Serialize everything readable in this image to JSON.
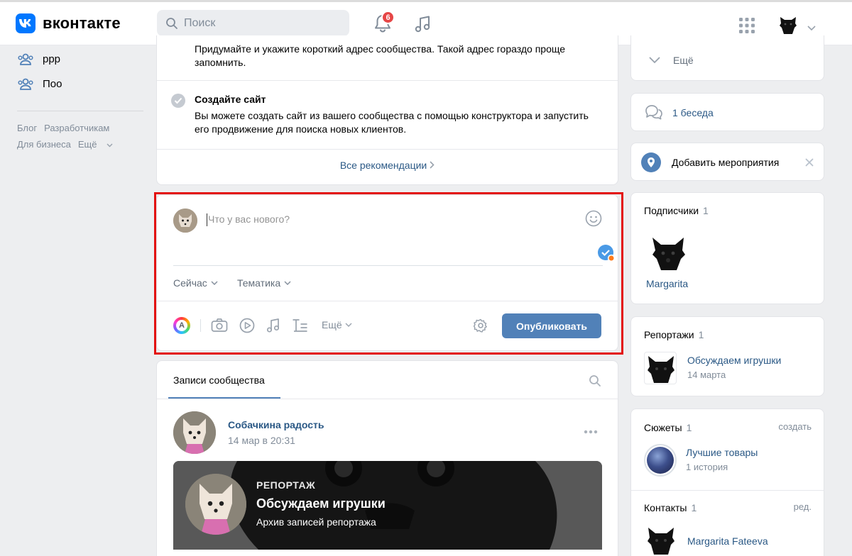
{
  "header": {
    "logo_text": "вконтакте",
    "search_placeholder": "Поиск",
    "notifications_count": "6"
  },
  "left": {
    "items": [
      "ррр",
      "Поо"
    ],
    "links": [
      "Блог",
      "Разработчикам",
      "Для бизнеса",
      "Ещё"
    ]
  },
  "tips": {
    "first_text": "Придумайте и укажите короткий адрес сообщества. Такой адрес гораздо проще запомнить.",
    "site_title": "Создайте сайт",
    "site_text": "Вы можете создать сайт из вашего сообщества с помощью конструктора и запустить его продвижение для поиска новых клиентов.",
    "all_recommendations": "Все рекомендации"
  },
  "composer": {
    "placeholder": "Что у вас нового?",
    "time_label": "Сейчас",
    "topic_label": "Тематика",
    "more_label": "Ещё",
    "publish_label": "Опубликовать"
  },
  "feed": {
    "tab_label": "Записи сообщества",
    "post": {
      "author": "Собачкина радость",
      "date": "14 мар в 20:31",
      "report_kicker": "РЕПОРТАЖ",
      "report_title": "Обсуждаем игрушки",
      "report_subtitle": "Архив записей репортажа"
    }
  },
  "right": {
    "more_label": "Ещё",
    "chat_label": "1 беседа",
    "event_label": "Добавить мероприятия",
    "followers_title": "Подписчики",
    "followers_count": "1",
    "follower_name": "Margarita",
    "reports_title": "Репортажи",
    "reports_count": "1",
    "report_name": "Обсуждаем игрушки",
    "report_date": "14 марта",
    "stories_title": "Сюжеты",
    "stories_count": "1",
    "stories_action": "создать",
    "story_name": "Лучшие товары",
    "story_count": "1 история",
    "contacts_title": "Контакты",
    "contacts_count": "1",
    "contacts_action": "ред.",
    "contact_name": "Margarita Fateeva"
  },
  "colors": {
    "accent": "#0077ff",
    "link": "#2a5885",
    "button": "#5181b8",
    "highlight_frame": "#e3110f",
    "badge": "#e64646"
  }
}
